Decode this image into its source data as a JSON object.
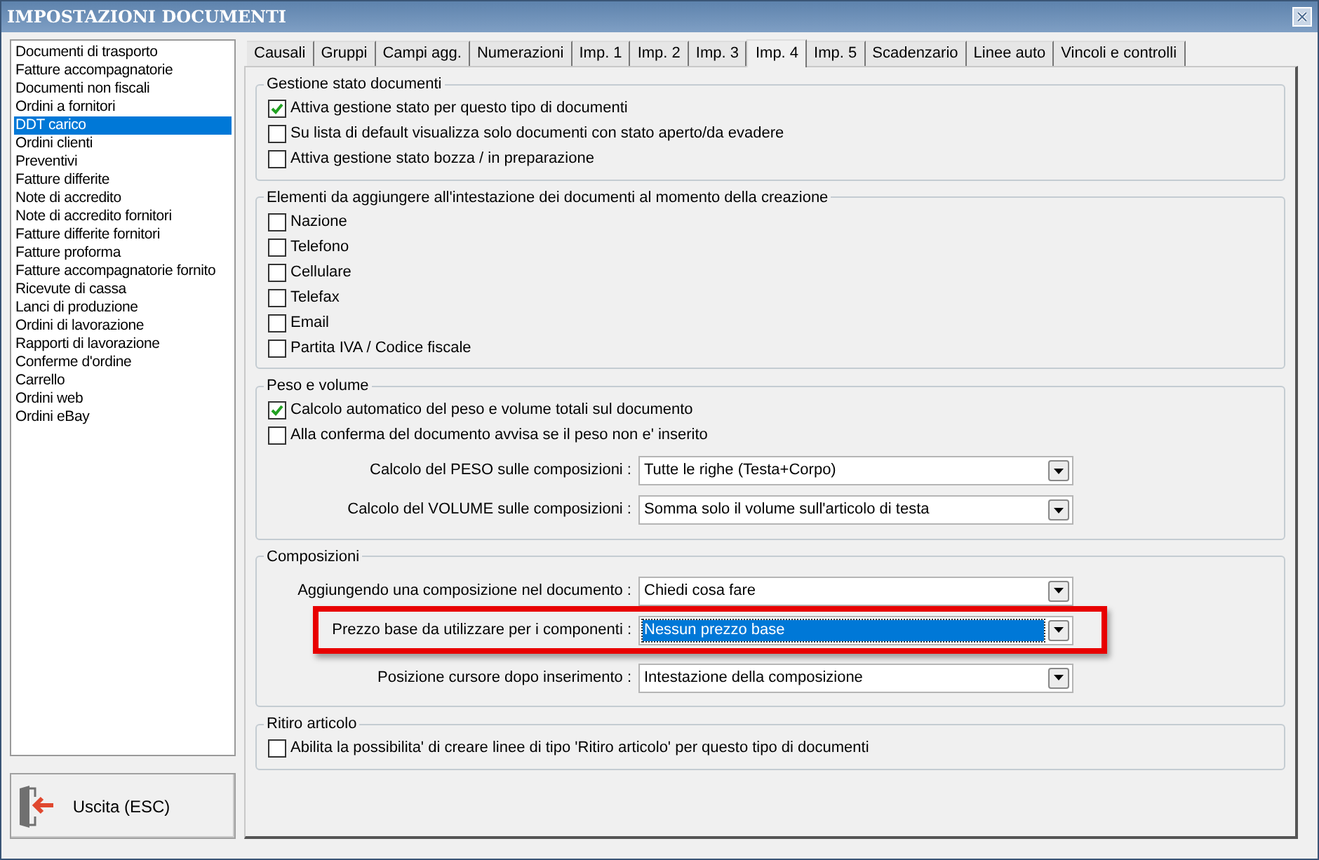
{
  "window": {
    "title": "IMPOSTAZIONI DOCUMENTI"
  },
  "sidebar": {
    "items": [
      {
        "label": "Documenti di trasporto",
        "selected": false
      },
      {
        "label": "Fatture accompagnatorie",
        "selected": false
      },
      {
        "label": "Documenti non fiscali",
        "selected": false
      },
      {
        "label": "Ordini a fornitori",
        "selected": false
      },
      {
        "label": "DDT carico",
        "selected": true
      },
      {
        "label": "Ordini clienti",
        "selected": false
      },
      {
        "label": "Preventivi",
        "selected": false
      },
      {
        "label": "Fatture differite",
        "selected": false
      },
      {
        "label": "Note di accredito",
        "selected": false
      },
      {
        "label": "Note di accredito fornitori",
        "selected": false
      },
      {
        "label": "Fatture differite fornitori",
        "selected": false
      },
      {
        "label": "Fatture proforma",
        "selected": false
      },
      {
        "label": "Fatture accompagnatorie fornito",
        "selected": false
      },
      {
        "label": "Ricevute di cassa",
        "selected": false
      },
      {
        "label": "Lanci di produzione",
        "selected": false
      },
      {
        "label": "Ordini di lavorazione",
        "selected": false
      },
      {
        "label": "Rapporti di lavorazione",
        "selected": false
      },
      {
        "label": "Conferme d'ordine",
        "selected": false
      },
      {
        "label": "Carrello",
        "selected": false
      },
      {
        "label": "Ordini web",
        "selected": false
      },
      {
        "label": "Ordini eBay",
        "selected": false
      }
    ]
  },
  "exit_button": {
    "label": "Uscita (ESC)"
  },
  "tabs": [
    {
      "label": "Causali",
      "selected": false
    },
    {
      "label": "Gruppi",
      "selected": false
    },
    {
      "label": "Campi agg.",
      "selected": false
    },
    {
      "label": "Numerazioni",
      "selected": false
    },
    {
      "label": "Imp. 1",
      "selected": false
    },
    {
      "label": "Imp. 2",
      "selected": false
    },
    {
      "label": "Imp. 3",
      "selected": false
    },
    {
      "label": "Imp. 4",
      "selected": true
    },
    {
      "label": "Imp. 5",
      "selected": false
    },
    {
      "label": "Scadenzario",
      "selected": false
    },
    {
      "label": "Linee auto",
      "selected": false
    },
    {
      "label": "Vincoli e controlli",
      "selected": false
    }
  ],
  "groups": [
    {
      "title": "Gestione stato documenti",
      "checkboxes": [
        {
          "label": "Attiva gestione stato per questo tipo di documenti",
          "checked": true
        },
        {
          "label": "Su lista di default visualizza solo documenti con stato aperto/da evadere",
          "checked": false
        },
        {
          "label": "Attiva gestione stato bozza / in preparazione",
          "checked": false
        }
      ]
    },
    {
      "title": "Elementi da aggiungere all'intestazione dei documenti al momento della creazione",
      "checkboxes": [
        {
          "label": "Nazione",
          "checked": false
        },
        {
          "label": "Telefono",
          "checked": false
        },
        {
          "label": "Cellulare",
          "checked": false
        },
        {
          "label": "Telefax",
          "checked": false
        },
        {
          "label": "Email",
          "checked": false
        },
        {
          "label": "Partita IVA / Codice fiscale",
          "checked": false
        }
      ]
    },
    {
      "title": "Peso e volume",
      "checkboxes": [
        {
          "label": "Calcolo automatico del peso e volume totali sul documento",
          "checked": true
        },
        {
          "label": "Alla conferma del documento avvisa se il peso non e' inserito",
          "checked": false
        }
      ],
      "combos": [
        {
          "label": "Calcolo del PESO sulle composizioni :",
          "value": "Tutte le righe (Testa+Corpo)",
          "focused": false,
          "highlighted": false
        },
        {
          "label": "Calcolo del VOLUME sulle composizioni :",
          "value": "Somma solo il volume sull'articolo di testa",
          "focused": false,
          "highlighted": false
        }
      ]
    },
    {
      "title": "Composizioni",
      "combos": [
        {
          "label": "Aggiungendo una composizione nel documento :",
          "value": "Chiedi cosa fare",
          "focused": false,
          "highlighted": false
        },
        {
          "label": "Prezzo base da utilizzare per i componenti :",
          "value": "Nessun prezzo base",
          "focused": true,
          "highlighted": true
        },
        {
          "label": "Posizione cursore dopo inserimento :",
          "value": "Intestazione della composizione",
          "focused": false,
          "highlighted": false
        }
      ]
    },
    {
      "title": "Ritiro articolo",
      "checkboxes": [
        {
          "label": "Abilita la possibilita' di creare linee di tipo 'Ritiro articolo' per questo tipo di documenti",
          "checked": false
        }
      ]
    }
  ]
}
